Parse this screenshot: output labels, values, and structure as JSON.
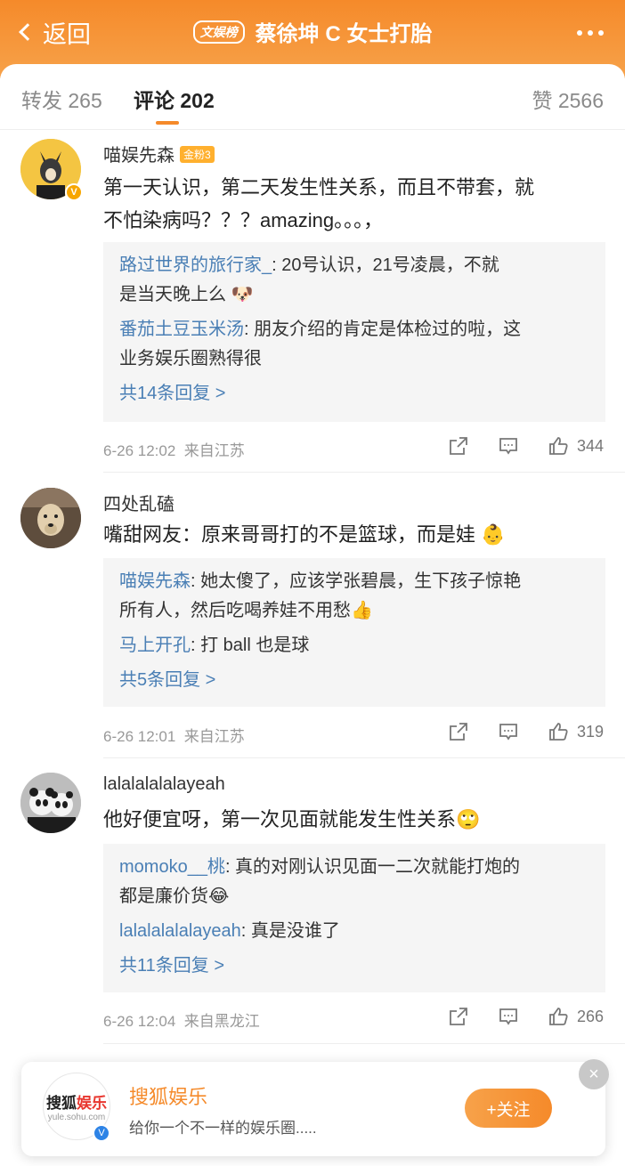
{
  "header": {
    "back_label": "返回",
    "badge": "文娱榜",
    "title": "蔡徐坤 C 女士打胎"
  },
  "tabs": {
    "repost": "转发 265",
    "comments": "评论 202",
    "likes": "赞 2566"
  },
  "comments": [
    {
      "username": "喵娱先森",
      "fan_badge": "金粉3",
      "text_line1": "第一天认识，第二天发生性关系，而且不带套，就",
      "text_line2": "不怕染病吗？？？amazing。。。，",
      "replies": [
        {
          "name": "路过世界的旅行家_",
          "text1": ": 20号认识，21号凌晨，不就",
          "text2": "是当天晚上么"
        },
        {
          "name": "番茄土豆玉米汤",
          "text1": ": 朋友介绍的肯定是体检过的啦，这",
          "text2": "业务娱乐圈熟得很"
        }
      ],
      "more_replies": "共14条回复 >",
      "time": "6-26 12:02",
      "source": "来自江苏",
      "likes": "344"
    },
    {
      "username": "四处乱磕",
      "text_line1": "嘴甜网友：原来哥哥打的不是篮球，而是娃",
      "replies": [
        {
          "name": "喵娱先森",
          "text1": ": 她太傻了，应该学张碧晨，生下孩子惊艳",
          "text2": "所有人，然后吃喝养娃不用愁"
        },
        {
          "name": "马上开孔",
          "text1": ": 打 ball 也是球"
        }
      ],
      "more_replies": "共5条回复 >",
      "time": "6-26 12:01",
      "source": "来自江苏",
      "likes": "319"
    },
    {
      "username": "lalalalalalayeah",
      "text_line1": "他好便宜呀，第一次见面就能发生性关系",
      "replies": [
        {
          "name": "momoko__桃",
          "text1": ": 真的对刚认识见面一二次就能打炮的",
          "text2": "都是廉价货"
        },
        {
          "name": "lalalalalalayeah",
          "text1": ": 真是没谁了"
        }
      ],
      "more_replies": "共11条回复 >",
      "time": "6-26 12:04",
      "source": "来自黑龙江",
      "likes": "266"
    }
  ],
  "ad": {
    "logo_text_a": "搜狐",
    "logo_text_b": "娱乐",
    "logo_url": "yule.sohu.com",
    "name": "搜狐娱乐",
    "desc": "给你一个不一样的娱乐圈.....",
    "follow_label": "+关注",
    "close_glyph": "×"
  },
  "colors": {
    "accent": "#f58a2a",
    "link": "#4a7fb5",
    "badge_gold": "#ffb02e"
  }
}
